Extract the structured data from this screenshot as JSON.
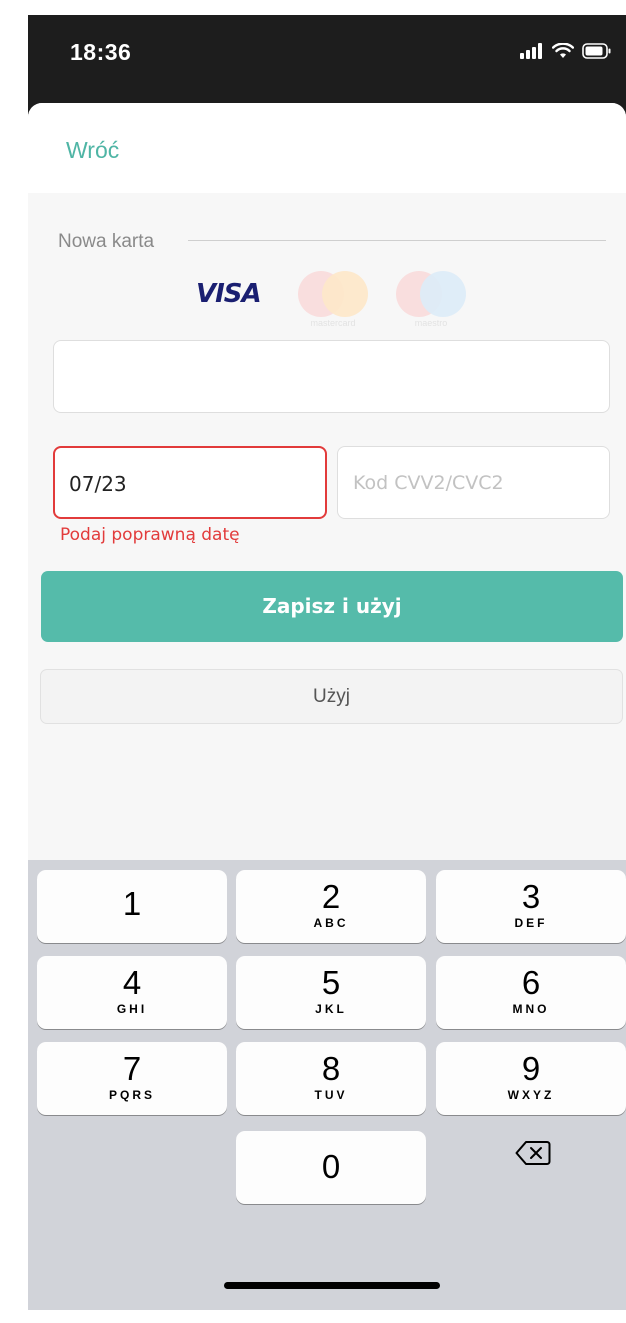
{
  "status_bar": {
    "time": "18:36"
  },
  "header": {
    "back_label": "Wróć"
  },
  "form": {
    "section_title": "Nowa karta",
    "card_brands": {
      "visa": "VISA",
      "mastercard": "mastercard",
      "maestro": "maestro"
    },
    "card_number": {
      "value": "",
      "placeholder": ""
    },
    "expiry": {
      "value": "07/23"
    },
    "cvv": {
      "placeholder": "Kod CVV2/CVC2"
    },
    "error_message": "Podaj poprawną datę"
  },
  "actions": {
    "save_and_use_label": "Zapisz i użyj",
    "use_label": "Użyj"
  },
  "keyboard": {
    "keys": [
      {
        "digit": "1",
        "letters": ""
      },
      {
        "digit": "2",
        "letters": "ABC"
      },
      {
        "digit": "3",
        "letters": "DEF"
      },
      {
        "digit": "4",
        "letters": "GHI"
      },
      {
        "digit": "5",
        "letters": "JKL"
      },
      {
        "digit": "6",
        "letters": "MNO"
      },
      {
        "digit": "7",
        "letters": "PQRS"
      },
      {
        "digit": "8",
        "letters": "TUV"
      },
      {
        "digit": "9",
        "letters": "WXYZ"
      },
      {
        "digit": "0",
        "letters": ""
      }
    ],
    "delete_icon": "backspace-icon"
  },
  "colors": {
    "accent": "#55bbaa",
    "back_link": "#4fb5a5",
    "error": "#e23b3b"
  }
}
